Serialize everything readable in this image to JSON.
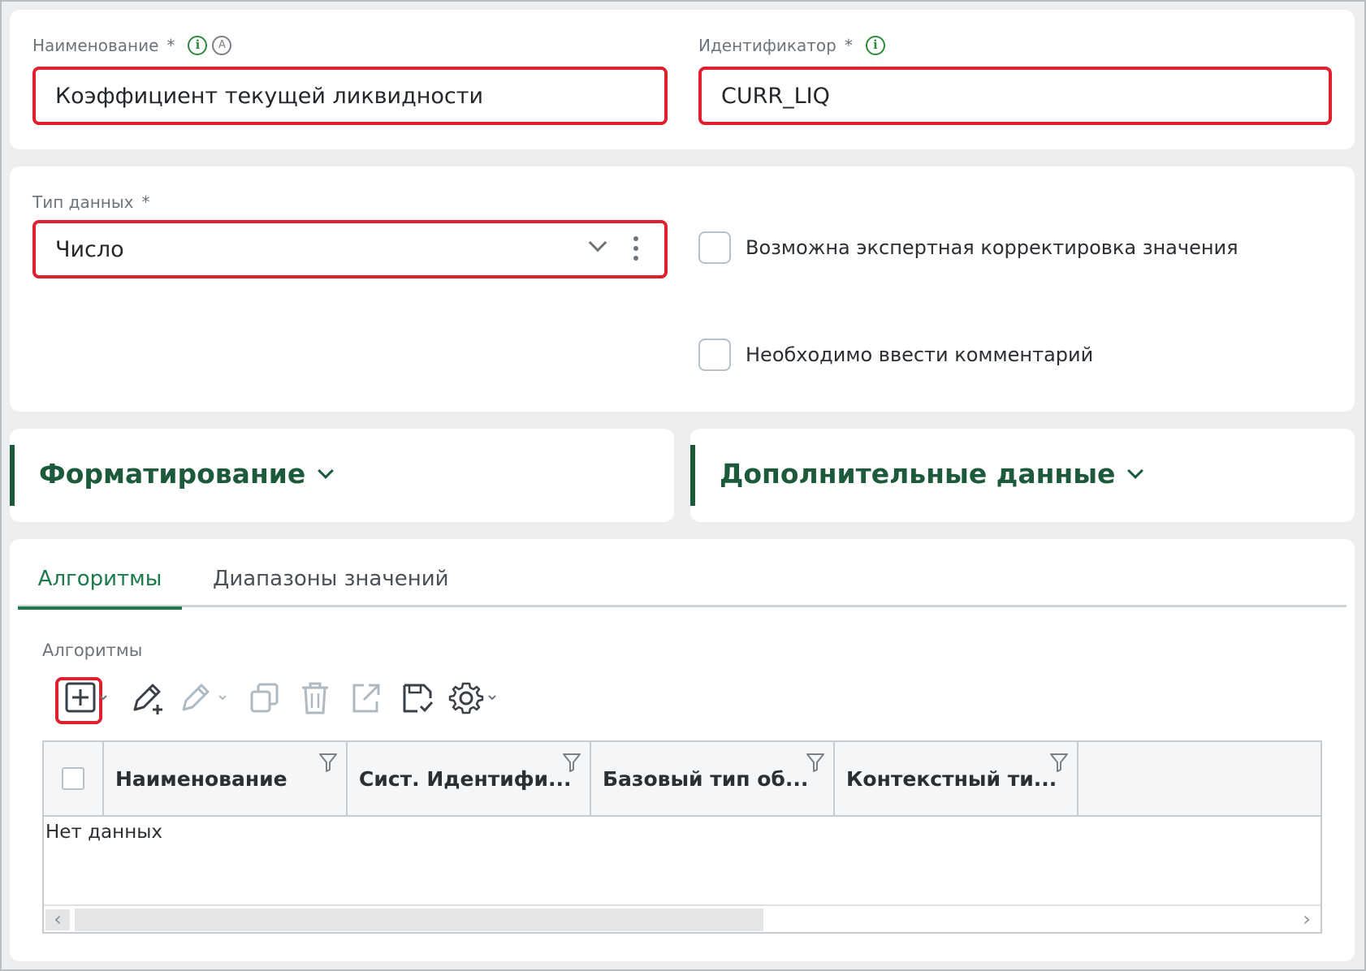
{
  "name_field": {
    "label": "Наименование",
    "required_mark": "*",
    "value": "Коэффициент текущей ликвидности",
    "info_icon": "info-icon",
    "auto_icon": "A"
  },
  "id_field": {
    "label": "Идентификатор",
    "required_mark": "*",
    "value": "CURR_LIQ",
    "info_icon": "info-icon"
  },
  "type_field": {
    "label": "Тип данных",
    "required_mark": "*",
    "value": "Число"
  },
  "checkboxes": {
    "expert_correction": "Возможна экспертная корректировка значения",
    "comment_required": "Необходимо ввести комментарий"
  },
  "sections": {
    "formatting": "Форматирование",
    "additional": "Дополнительные данные"
  },
  "tabs": {
    "algorithms": "Алгоритмы",
    "ranges": "Диапазоны значений"
  },
  "algorithms_panel": {
    "label": "Алгоритмы",
    "toolbar_icons": [
      "add-icon",
      "edit-add-icon",
      "edit-icon",
      "copy-icon",
      "delete-icon",
      "open-external-icon",
      "save-check-icon",
      "settings-icon"
    ],
    "columns": [
      "Наименование",
      "Сист. Идентифи...",
      "Базовый тип об...",
      "Контекстный ти..."
    ],
    "empty_text": "Нет данных"
  },
  "colors": {
    "accent_green": "#1d7a4a",
    "section_green": "#1d5a3c",
    "highlight_red": "#e0202f",
    "info_green": "#2e8b3e"
  }
}
